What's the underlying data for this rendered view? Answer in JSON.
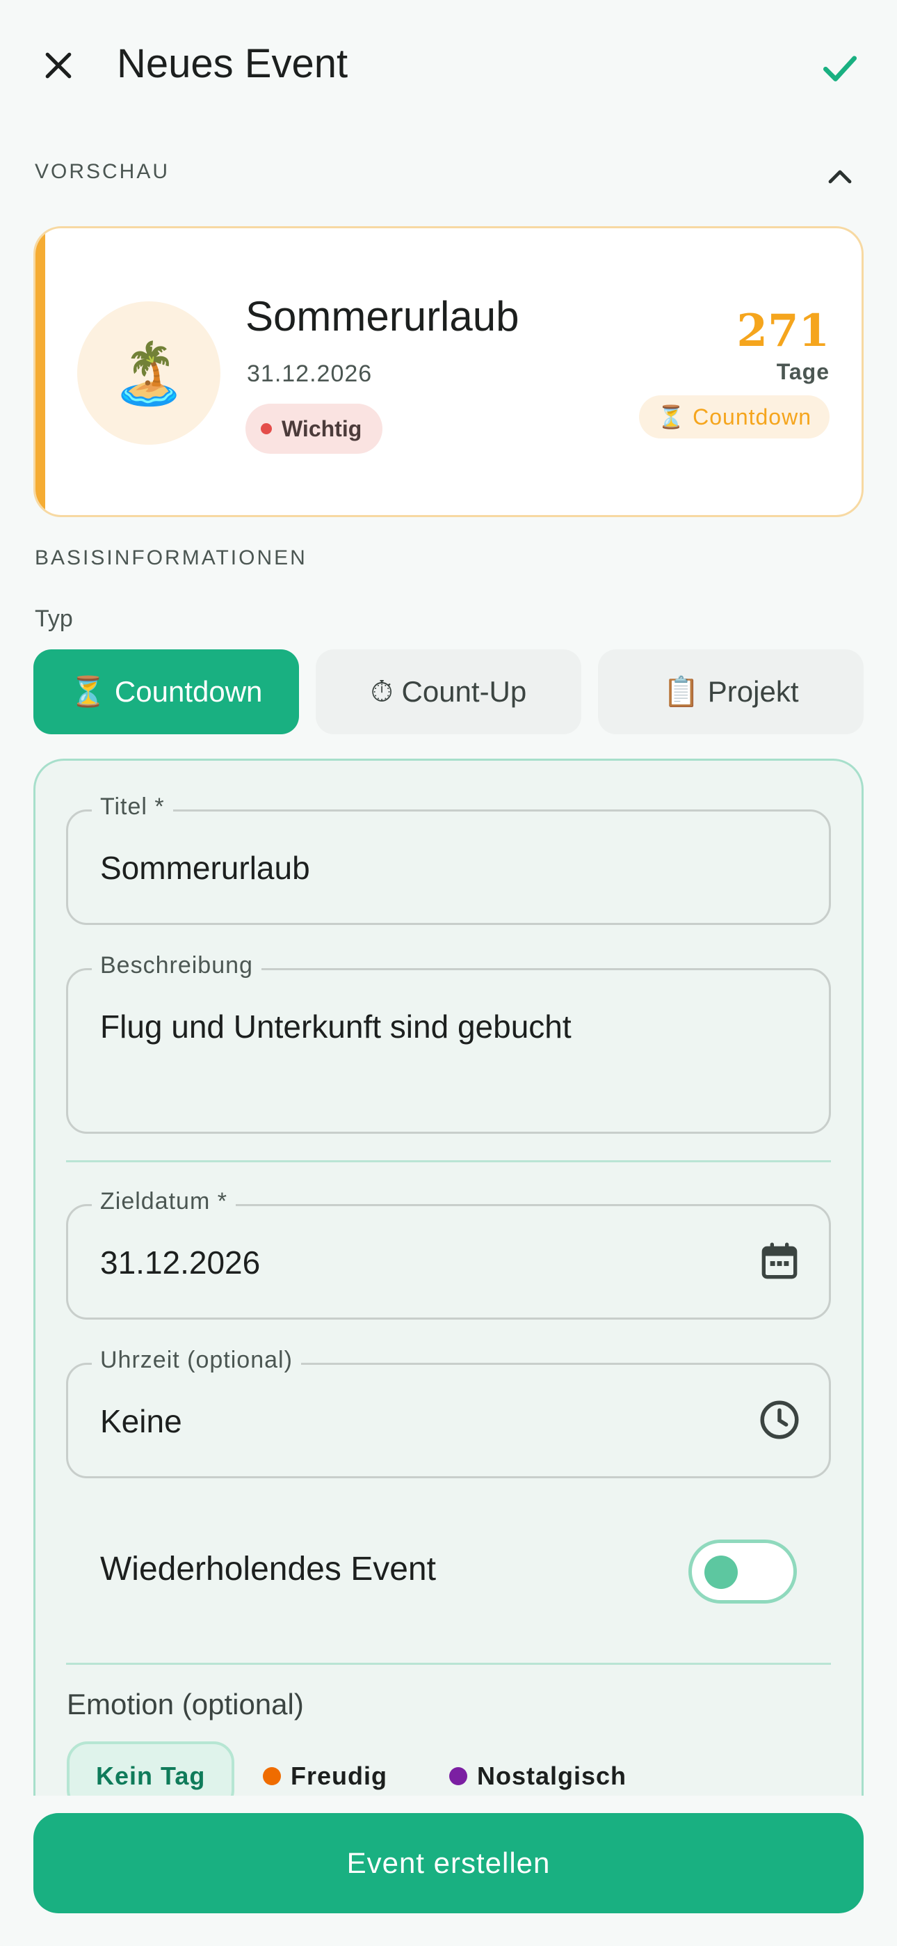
{
  "appbar": {
    "title": "Neues Event"
  },
  "preview": {
    "section_label": "VORSCHAU",
    "emoji": "🏝️",
    "title": "Sommerurlaub",
    "date": "31.12.2026",
    "priority": "Wichtig",
    "count": "271",
    "unit": "Tage",
    "type_icon": "⏳",
    "type_label": "Countdown",
    "colors": {
      "accent": "#f5ac33",
      "priority_dot": "#e44d4a"
    }
  },
  "basis": {
    "section_label": "BASISINFORMATIONEN",
    "type_label": "Typ"
  },
  "types": [
    {
      "icon": "⏳",
      "label": "Countdown",
      "active": true
    },
    {
      "icon": "⏱",
      "label": "Count-Up",
      "active": false
    },
    {
      "icon": "📋",
      "label": "Projekt",
      "active": false
    }
  ],
  "form": {
    "title": {
      "label": "Titel *",
      "value": "Sommerurlaub"
    },
    "description": {
      "label": "Beschreibung",
      "value": "Flug und Unterkunft sind gebucht"
    },
    "target_date": {
      "label": "Zieldatum *",
      "value": "31.12.2026",
      "icon": "calendar-icon"
    },
    "time": {
      "label": "Uhrzeit (optional)",
      "value": "Keine",
      "icon": "clock-icon"
    },
    "recurring": {
      "label": "Wiederholendes Event",
      "enabled": false
    }
  },
  "emotion": {
    "label": "Emotion (optional)",
    "chips": [
      {
        "label": "Kein Tag",
        "selected": true,
        "color": ""
      },
      {
        "label": "Freudig",
        "selected": false,
        "color": "#ef6c00"
      },
      {
        "label": "Nostalgisch",
        "selected": false,
        "color": "#7b1fa2"
      }
    ]
  },
  "primary_action": "Event erstellen",
  "theme": {
    "primary": "#19b081"
  }
}
